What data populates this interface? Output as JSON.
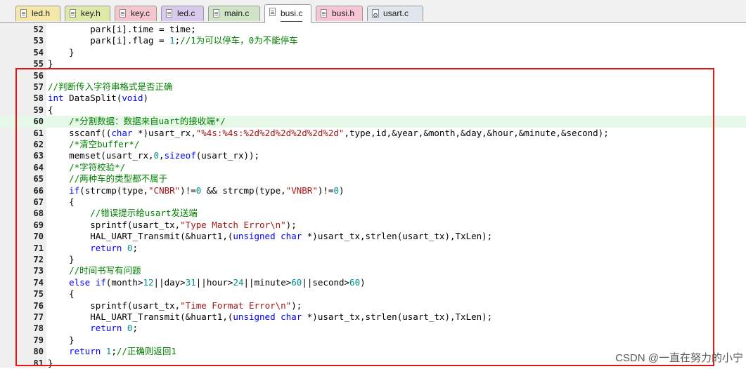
{
  "tabs": [
    {
      "label": "led.h",
      "color": "#f5e7a8",
      "icon": "header-file-icon",
      "active": false
    },
    {
      "label": "key.h",
      "color": "#dfe8a6",
      "icon": "header-file-icon",
      "active": false
    },
    {
      "label": "key.c",
      "color": "#f6c6cf",
      "icon": "source-file-icon",
      "active": false
    },
    {
      "label": "led.c",
      "color": "#d9c9ec",
      "icon": "source-file-icon",
      "active": false
    },
    {
      "label": "main.c",
      "color": "#cfe4c4",
      "icon": "source-file-icon",
      "active": false
    },
    {
      "label": "busi.c",
      "color": "#ffffff",
      "icon": "source-file-icon",
      "active": true
    },
    {
      "label": "busi.h",
      "color": "#f6c6d6",
      "icon": "header-file-icon",
      "active": false
    },
    {
      "label": "usart.c",
      "color": "#dfe6ee",
      "icon": "gear-file-icon",
      "active": false
    }
  ],
  "colors": {
    "keyword": "#0000ff",
    "string": "#a31515",
    "number": "#009090",
    "comment": "#008000",
    "highlight_line": "#e8f8e8",
    "annotation_box": "#e01818"
  },
  "code": [
    {
      "no": "52",
      "fold": "",
      "tokens": [
        [
          "p",
          "        park[i].time = time;"
        ]
      ]
    },
    {
      "no": "53",
      "fold": "",
      "tokens": [
        [
          "p",
          "        park[i].flag = "
        ],
        [
          "n",
          "1"
        ],
        [
          "p",
          ";"
        ],
        [
          "c",
          "//1为可以停车，0为不能停车"
        ]
      ]
    },
    {
      "no": "54",
      "fold": "",
      "tokens": [
        [
          "p",
          "    }"
        ]
      ]
    },
    {
      "no": "55",
      "fold": "",
      "tokens": [
        [
          "p",
          "}"
        ]
      ]
    },
    {
      "no": "56",
      "fold": "",
      "tokens": []
    },
    {
      "no": "57",
      "fold": "",
      "tokens": [
        [
          "c",
          "//判断传入字符串格式是否正确"
        ]
      ]
    },
    {
      "no": "58",
      "fold": "",
      "tokens": [
        [
          "k",
          "int"
        ],
        [
          "p",
          " DataSplit("
        ],
        [
          "k",
          "void"
        ],
        [
          "p",
          ")"
        ]
      ]
    },
    {
      "no": "59",
      "fold": "",
      "tokens": [
        [
          "p",
          "{"
        ]
      ]
    },
    {
      "no": "60",
      "fold": "",
      "hl": true,
      "tokens": [
        [
          "p",
          "    "
        ],
        [
          "c",
          "/*分割数据：数据来自uart的接收端*/"
        ]
      ]
    },
    {
      "no": "61",
      "fold": "",
      "tokens": [
        [
          "p",
          "    sscanf(("
        ],
        [
          "k",
          "char"
        ],
        [
          "p",
          " *)usart_rx,"
        ],
        [
          "s",
          "\"%4s:%4s:%2d%2d%2d%2d%2d%2d\""
        ],
        [
          "p",
          ",type,id,&year,&month,&day,&hour,&minute,&second);"
        ]
      ]
    },
    {
      "no": "62",
      "fold": "",
      "tokens": [
        [
          "p",
          "    "
        ],
        [
          "c",
          "/*清空buffer*/"
        ]
      ]
    },
    {
      "no": "63",
      "fold": "",
      "tokens": [
        [
          "p",
          "    memset(usart_rx,"
        ],
        [
          "n",
          "0"
        ],
        [
          "p",
          ","
        ],
        [
          "k",
          "sizeof"
        ],
        [
          "p",
          "(usart_rx));"
        ]
      ]
    },
    {
      "no": "64",
      "fold": "",
      "tokens": [
        [
          "p",
          "    "
        ],
        [
          "c",
          "/*字符校验*/"
        ]
      ]
    },
    {
      "no": "65",
      "fold": "",
      "tokens": [
        [
          "p",
          "    "
        ],
        [
          "c",
          "//两种车的类型都不属于"
        ]
      ]
    },
    {
      "no": "66",
      "fold": "",
      "tokens": [
        [
          "p",
          "    "
        ],
        [
          "k",
          "if"
        ],
        [
          "p",
          "(strcmp(type,"
        ],
        [
          "s",
          "\"CNBR\""
        ],
        [
          "p",
          ")!="
        ],
        [
          "n",
          "0"
        ],
        [
          "p",
          " && strcmp(type,"
        ],
        [
          "s",
          "\"VNBR\""
        ],
        [
          "p",
          ")!="
        ],
        [
          "n",
          "0"
        ],
        [
          "p",
          ")"
        ]
      ]
    },
    {
      "no": "67",
      "fold": "",
      "tokens": [
        [
          "p",
          "    {"
        ]
      ]
    },
    {
      "no": "68",
      "fold": "",
      "tokens": [
        [
          "p",
          "        "
        ],
        [
          "c",
          "//错误提示给usart发送端"
        ]
      ]
    },
    {
      "no": "69",
      "fold": "",
      "tokens": [
        [
          "p",
          "        sprintf(usart_tx,"
        ],
        [
          "s",
          "\"Type Match Error\\n\""
        ],
        [
          "p",
          ");"
        ]
      ]
    },
    {
      "no": "70",
      "fold": "",
      "tokens": [
        [
          "p",
          "        HAL_UART_Transmit(&huart1,("
        ],
        [
          "k",
          "unsigned char"
        ],
        [
          "p",
          " *)usart_tx,strlen(usart_tx),TxLen);"
        ]
      ]
    },
    {
      "no": "71",
      "fold": "",
      "tokens": [
        [
          "p",
          "        "
        ],
        [
          "k",
          "return"
        ],
        [
          "p",
          " "
        ],
        [
          "n",
          "0"
        ],
        [
          "p",
          ";"
        ]
      ]
    },
    {
      "no": "72",
      "fold": "",
      "tokens": [
        [
          "p",
          "    }"
        ]
      ]
    },
    {
      "no": "73",
      "fold": "",
      "tokens": [
        [
          "p",
          "    "
        ],
        [
          "c",
          "//时间书写有问题"
        ]
      ]
    },
    {
      "no": "74",
      "fold": "",
      "tokens": [
        [
          "p",
          "    "
        ],
        [
          "k",
          "else if"
        ],
        [
          "p",
          "(month>"
        ],
        [
          "n",
          "12"
        ],
        [
          "p",
          "||day>"
        ],
        [
          "n",
          "31"
        ],
        [
          "p",
          "||hour>"
        ],
        [
          "n",
          "24"
        ],
        [
          "p",
          "||minute>"
        ],
        [
          "n",
          "60"
        ],
        [
          "p",
          "||second>"
        ],
        [
          "n",
          "60"
        ],
        [
          "p",
          ")"
        ]
      ]
    },
    {
      "no": "75",
      "fold": "",
      "tokens": [
        [
          "p",
          "    {"
        ]
      ]
    },
    {
      "no": "76",
      "fold": "",
      "tokens": [
        [
          "p",
          "        sprintf(usart_tx,"
        ],
        [
          "s",
          "\"Time Format Error\\n\""
        ],
        [
          "p",
          ");"
        ]
      ]
    },
    {
      "no": "77",
      "fold": "",
      "tokens": [
        [
          "p",
          "        HAL_UART_Transmit(&huart1,("
        ],
        [
          "k",
          "unsigned char"
        ],
        [
          "p",
          " *)usart_tx,strlen(usart_tx),TxLen);"
        ]
      ]
    },
    {
      "no": "78",
      "fold": "",
      "tokens": [
        [
          "p",
          "        "
        ],
        [
          "k",
          "return"
        ],
        [
          "p",
          " "
        ],
        [
          "n",
          "0"
        ],
        [
          "p",
          ";"
        ]
      ]
    },
    {
      "no": "79",
      "fold": "",
      "tokens": [
        [
          "p",
          "    }"
        ]
      ]
    },
    {
      "no": "80",
      "fold": "",
      "tokens": [
        [
          "p",
          "    "
        ],
        [
          "k",
          "return"
        ],
        [
          "p",
          " "
        ],
        [
          "n",
          "1"
        ],
        [
          "p",
          ";"
        ],
        [
          "c",
          "//正确则返回1"
        ]
      ]
    },
    {
      "no": "81",
      "fold": "",
      "tokens": [
        [
          "p",
          "}"
        ]
      ]
    }
  ],
  "watermark": "CSDN @一直在努力的小宁"
}
